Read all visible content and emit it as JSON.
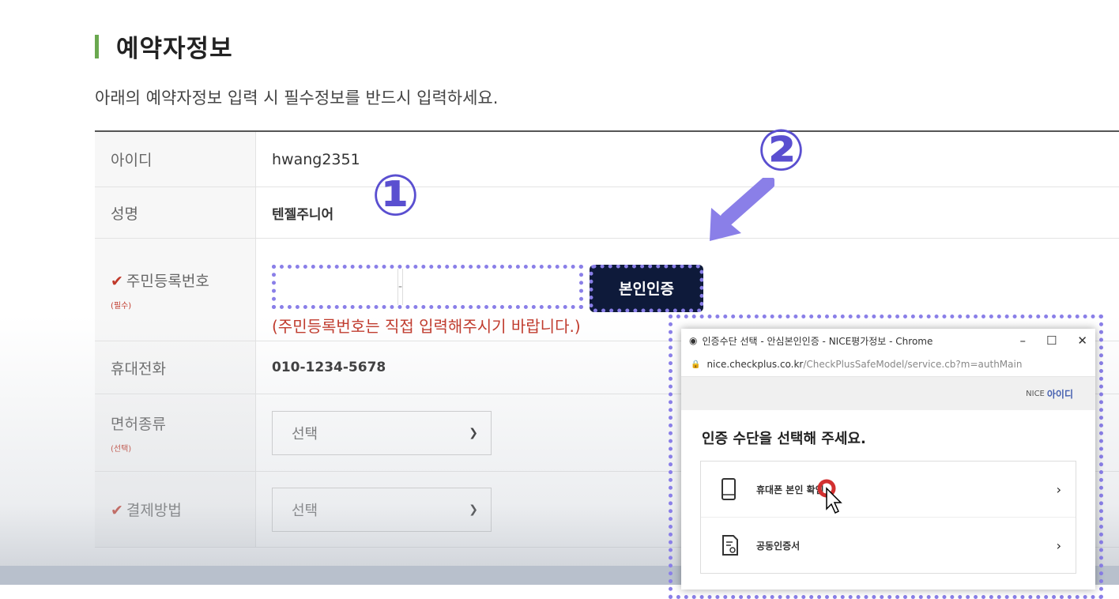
{
  "section": {
    "title": "예약자정보",
    "description": "아래의 예약자정보 입력 시 필수정보를 반드시 입력하세요."
  },
  "form": {
    "id_label": "아이디",
    "id_value": "hwang2351",
    "name_label": "성명",
    "name_value": "텐젤주니어",
    "jumin_label": "주민등록번호",
    "jumin_required": "(필수)",
    "jumin_dash": "-",
    "verify_button": "본인인증",
    "jumin_note": "(주민등록번호는 직접 입력해주시기 바랍니다.)",
    "phone_label": "휴대전화",
    "phone_value": "010-1234-5678",
    "license_label": "면허종류",
    "license_optional": "(선택)",
    "license_select": "선택",
    "payment_label": "결제방법",
    "payment_select": "선택"
  },
  "annotations": {
    "step1": "①",
    "step2": "②"
  },
  "popup": {
    "window_title": "인증수단 선택 - 안심본인인증 - NICE평가정보 - Chrome",
    "minimize": "–",
    "maximize": "☐",
    "close": "✕",
    "url_domain": "nice.checkplus.co.kr",
    "url_path": "/CheckPlusSafeModel/service.cb?m=authMain",
    "logo_prefix": "NICE",
    "logo_brand": "아이디",
    "heading": "인증 수단을 선택해 주세요.",
    "options": [
      {
        "label": "휴대폰 본인 확인",
        "icon": "phone-icon"
      },
      {
        "label": "공동인증서",
        "icon": "certificate-icon"
      }
    ],
    "chevron": "›"
  },
  "colors": {
    "accent_green": "#6aa84f",
    "annotation_purple": "#8a7fe8",
    "button_navy": "#0e1a3a",
    "warning_red": "#c0392b"
  }
}
